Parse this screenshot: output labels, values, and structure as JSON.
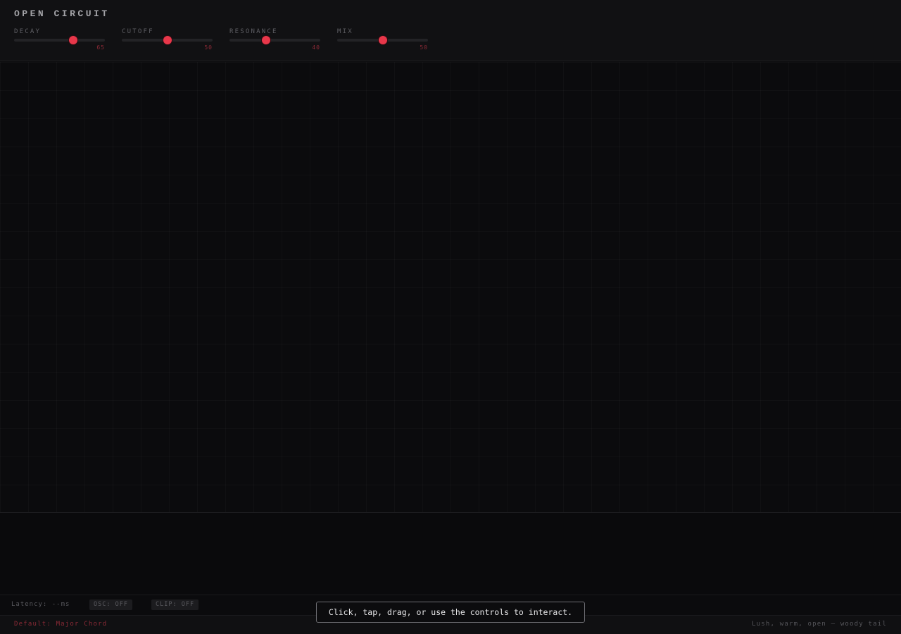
{
  "app": {
    "title": "OPEN CIRCUIT"
  },
  "controls": {
    "sliders": [
      {
        "label": "DECAY",
        "value": "65",
        "fraction": 0.65
      },
      {
        "label": "CUTOFF",
        "value": "50",
        "fraction": 0.5
      },
      {
        "label": "RESONANCE",
        "value": "40",
        "fraction": 0.4
      },
      {
        "label": "MIX",
        "value": "50",
        "fraction": 0.5
      }
    ]
  },
  "status": {
    "latency": "Latency: --ms",
    "osc": "OSC: OFF",
    "clip": "CLIP: OFF"
  },
  "hint": "Click, tap, drag, or use the controls to interact.",
  "footer": {
    "preset": "Default: Major Chord",
    "description": "Lush, warm, open — woody tail"
  },
  "colors": {
    "accent": "#e8374a",
    "background": "#0b0b0d",
    "panel": "#111113"
  }
}
